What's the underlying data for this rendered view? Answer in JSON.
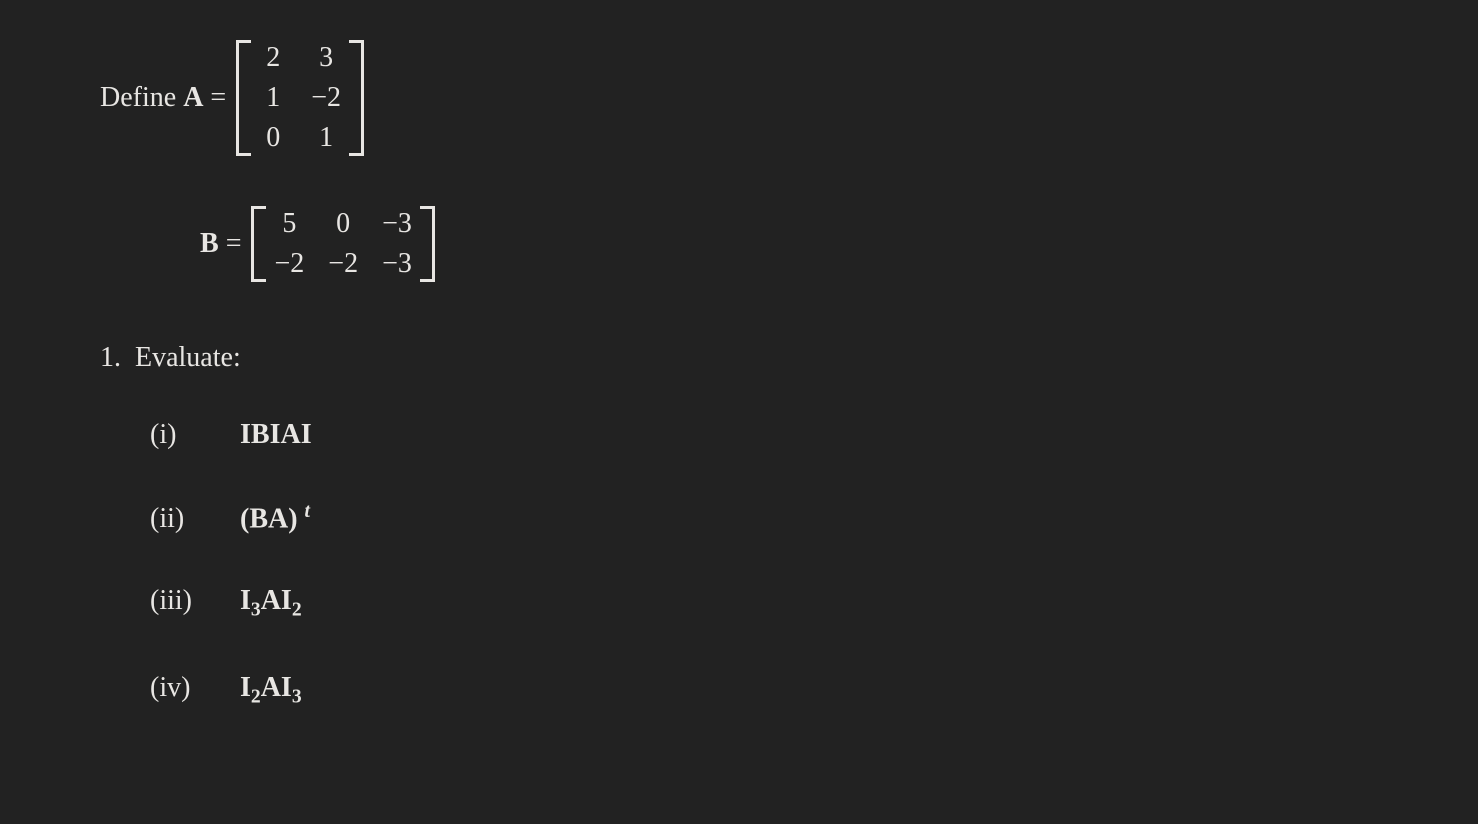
{
  "def": {
    "prefix": "Define ",
    "A_name": "A",
    "eq": " = ",
    "B_name": "B",
    "A": {
      "r1c1": "2",
      "r1c2": "3",
      "r2c1": "1",
      "r2c2": "−2",
      "r3c1": "0",
      "r3c2": "1"
    },
    "B": {
      "r1c1": "5",
      "r1c2": "0",
      "r1c3": "−3",
      "r2c1": "−2",
      "r2c2": "−2",
      "r2c3": "−3"
    }
  },
  "q": {
    "num": "1.",
    "text": "Evaluate:"
  },
  "sub": {
    "i": {
      "label": "(i)",
      "expr_pre": "IBIAI",
      "sup": "",
      "sub1": "",
      "sub2": ""
    },
    "ii": {
      "label": "(ii)",
      "expr_pre": "(BA)",
      "sup": "t",
      "sub1": "",
      "sub2": ""
    },
    "iii": {
      "label": "(iii)",
      "expr_pre": "I",
      "sub1": "3",
      "mid": "AI",
      "sub2": "2"
    },
    "iv": {
      "label": "(iv)",
      "expr_pre": "I",
      "sub1": "2",
      "mid": "AI",
      "sub2": "3"
    }
  }
}
